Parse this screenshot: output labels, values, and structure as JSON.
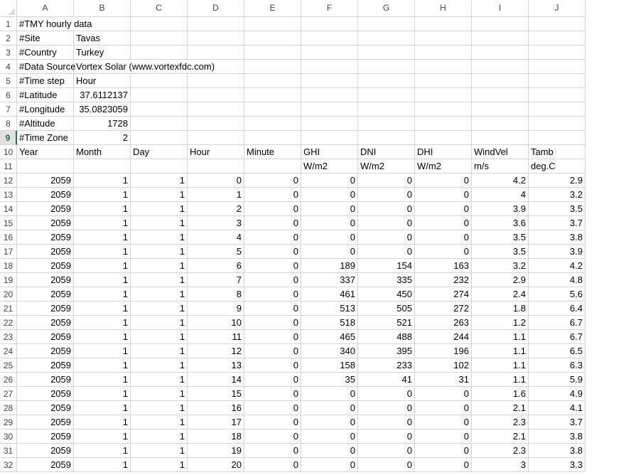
{
  "columns": [
    "A",
    "B",
    "C",
    "D",
    "E",
    "F",
    "G",
    "H",
    "I",
    "J"
  ],
  "active_row": 9,
  "rows": [
    {
      "num": "1",
      "cells": [
        "#TMY hourly data",
        "",
        "",
        "",
        "",
        "",
        "",
        "",
        "",
        ""
      ]
    },
    {
      "num": "2",
      "cells": [
        "#Site",
        "Tavas",
        "",
        "",
        "",
        "",
        "",
        "",
        "",
        ""
      ]
    },
    {
      "num": "3",
      "cells": [
        "#Country",
        "Turkey",
        "",
        "",
        "",
        "",
        "",
        "",
        "",
        ""
      ]
    },
    {
      "num": "4",
      "cells": [
        "#Data Source",
        "Vortex Solar (www.vortexfdc.com)",
        "",
        "",
        "",
        "",
        "",
        "",
        "",
        ""
      ]
    },
    {
      "num": "5",
      "cells": [
        "#Time step",
        "Hour",
        "",
        "",
        "",
        "",
        "",
        "",
        "",
        ""
      ]
    },
    {
      "num": "6",
      "cells": [
        "#Latitude",
        "37.6112137",
        "",
        "",
        "",
        "",
        "",
        "",
        "",
        ""
      ]
    },
    {
      "num": "7",
      "cells": [
        "#Longitude",
        "35.0823059",
        "",
        "",
        "",
        "",
        "",
        "",
        "",
        ""
      ]
    },
    {
      "num": "8",
      "cells": [
        "#Altitude",
        "1728",
        "",
        "",
        "",
        "",
        "",
        "",
        "",
        ""
      ]
    },
    {
      "num": "9",
      "cells": [
        "#Time Zone",
        "2",
        "",
        "",
        "",
        "",
        "",
        "",
        "",
        ""
      ]
    },
    {
      "num": "10",
      "cells": [
        "Year",
        "Month",
        "Day",
        "Hour",
        "Minute",
        "GHI",
        "DNI",
        "DHI",
        "WindVel",
        "Tamb"
      ]
    },
    {
      "num": "11",
      "cells": [
        "",
        "",
        "",
        "",
        "",
        "W/m2",
        "W/m2",
        "W/m2",
        "m/s",
        "deg.C"
      ]
    },
    {
      "num": "12",
      "cells": [
        "2059",
        "1",
        "1",
        "0",
        "0",
        "0",
        "0",
        "0",
        "4.2",
        "2.9"
      ]
    },
    {
      "num": "13",
      "cells": [
        "2059",
        "1",
        "1",
        "1",
        "0",
        "0",
        "0",
        "0",
        "4",
        "3.2"
      ]
    },
    {
      "num": "14",
      "cells": [
        "2059",
        "1",
        "1",
        "2",
        "0",
        "0",
        "0",
        "0",
        "3.9",
        "3.5"
      ]
    },
    {
      "num": "15",
      "cells": [
        "2059",
        "1",
        "1",
        "3",
        "0",
        "0",
        "0",
        "0",
        "3.6",
        "3.7"
      ]
    },
    {
      "num": "16",
      "cells": [
        "2059",
        "1",
        "1",
        "4",
        "0",
        "0",
        "0",
        "0",
        "3.5",
        "3.8"
      ]
    },
    {
      "num": "17",
      "cells": [
        "2059",
        "1",
        "1",
        "5",
        "0",
        "0",
        "0",
        "0",
        "3.5",
        "3.9"
      ]
    },
    {
      "num": "18",
      "cells": [
        "2059",
        "1",
        "1",
        "6",
        "0",
        "189",
        "154",
        "163",
        "3.2",
        "4.2"
      ]
    },
    {
      "num": "19",
      "cells": [
        "2059",
        "1",
        "1",
        "7",
        "0",
        "337",
        "335",
        "232",
        "2.9",
        "4.8"
      ]
    },
    {
      "num": "20",
      "cells": [
        "2059",
        "1",
        "1",
        "8",
        "0",
        "461",
        "450",
        "274",
        "2.4",
        "5.6"
      ]
    },
    {
      "num": "21",
      "cells": [
        "2059",
        "1",
        "1",
        "9",
        "0",
        "513",
        "505",
        "272",
        "1.8",
        "6.4"
      ]
    },
    {
      "num": "22",
      "cells": [
        "2059",
        "1",
        "1",
        "10",
        "0",
        "518",
        "521",
        "263",
        "1.2",
        "6.7"
      ]
    },
    {
      "num": "23",
      "cells": [
        "2059",
        "1",
        "1",
        "11",
        "0",
        "465",
        "488",
        "244",
        "1.1",
        "6.7"
      ]
    },
    {
      "num": "24",
      "cells": [
        "2059",
        "1",
        "1",
        "12",
        "0",
        "340",
        "395",
        "196",
        "1.1",
        "6.5"
      ]
    },
    {
      "num": "25",
      "cells": [
        "2059",
        "1",
        "1",
        "13",
        "0",
        "158",
        "233",
        "102",
        "1.1",
        "6.3"
      ]
    },
    {
      "num": "26",
      "cells": [
        "2059",
        "1",
        "1",
        "14",
        "0",
        "35",
        "41",
        "31",
        "1.1",
        "5.9"
      ]
    },
    {
      "num": "27",
      "cells": [
        "2059",
        "1",
        "1",
        "15",
        "0",
        "0",
        "0",
        "0",
        "1.6",
        "4.9"
      ]
    },
    {
      "num": "28",
      "cells": [
        "2059",
        "1",
        "1",
        "16",
        "0",
        "0",
        "0",
        "0",
        "2.1",
        "4.1"
      ]
    },
    {
      "num": "29",
      "cells": [
        "2059",
        "1",
        "1",
        "17",
        "0",
        "0",
        "0",
        "0",
        "2.3",
        "3.7"
      ]
    },
    {
      "num": "30",
      "cells": [
        "2059",
        "1",
        "1",
        "18",
        "0",
        "0",
        "0",
        "0",
        "2.1",
        "3.8"
      ]
    },
    {
      "num": "31",
      "cells": [
        "2059",
        "1",
        "1",
        "19",
        "0",
        "0",
        "0",
        "0",
        "2.3",
        "3.8"
      ]
    },
    {
      "num": "32",
      "cells": [
        "2059",
        "1",
        "1",
        "20",
        "0",
        "0",
        "0",
        "0",
        "3",
        "3.3"
      ]
    }
  ]
}
